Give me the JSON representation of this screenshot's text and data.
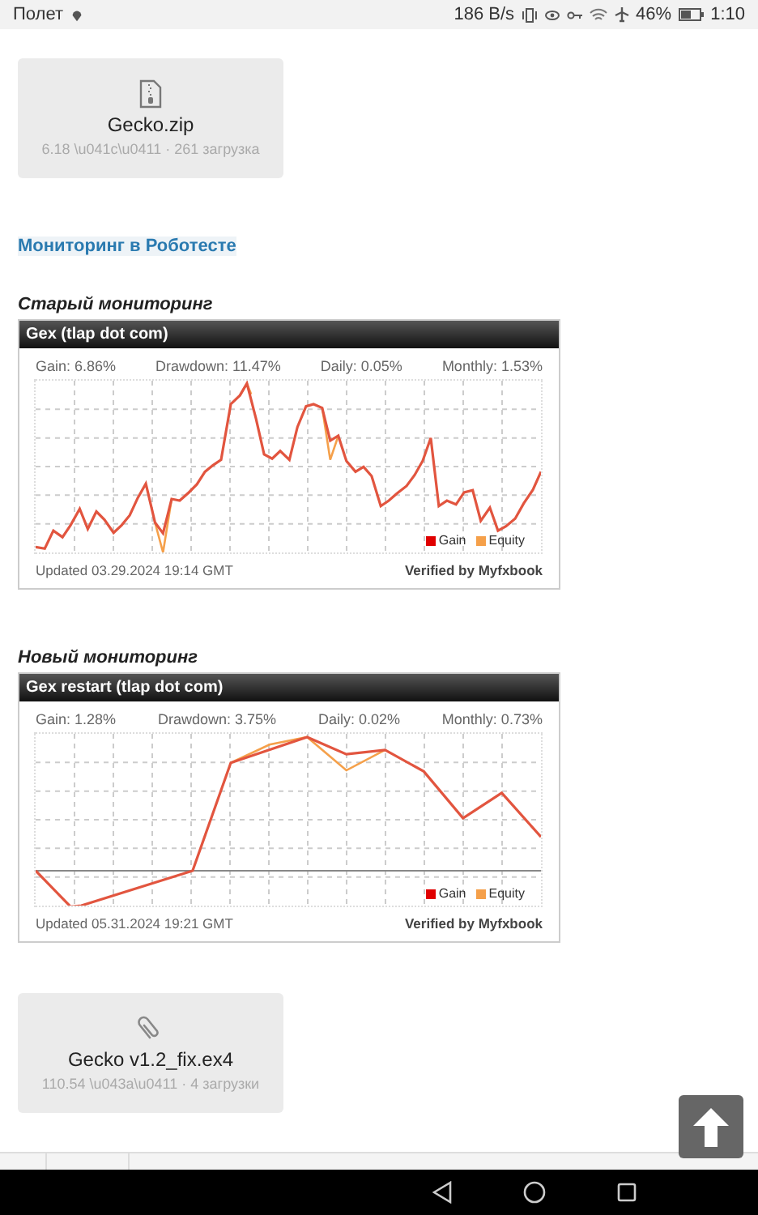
{
  "status_bar": {
    "carrier": "Полет",
    "speed": "186 B/s",
    "battery": "46%",
    "time": "1:10"
  },
  "files": [
    {
      "kind": "zip",
      "name": "Gecko.zip",
      "meta": "6.18 \\u041c\\u0411 · 261 загрузка"
    }
  ],
  "section_link": "Мониторинг в Роботесте",
  "monitors": [
    {
      "label": "Старый мониторинг",
      "title": "Gex (tlap dot com)",
      "stats": [
        "Gain: 6.86%",
        "Drawdown: 11.47%",
        "Daily: 0.05%",
        "Monthly: 1.53%"
      ],
      "legend": [
        "Gain",
        "Equity"
      ],
      "updated": "Updated 03.29.2024 19:14 GMT",
      "verified": "Verified by Myfxbook"
    },
    {
      "label": "Новый мониторинг",
      "title": "Gex restart (tlap dot com)",
      "stats": [
        "Gain: 1.28%",
        "Drawdown: 3.75%",
        "Daily: 0.02%",
        "Monthly: 0.73%"
      ],
      "legend": [
        "Gain",
        "Equity"
      ],
      "updated": "Updated 05.31.2024 19:21 GMT",
      "verified": "Verified by Myfxbook"
    }
  ],
  "files_bottom": [
    {
      "kind": "attachment",
      "name": "Gecko v1.2_fix.ex4",
      "meta": "110.54 \\u043a\\u0411 · 4 загрузки"
    }
  ]
}
